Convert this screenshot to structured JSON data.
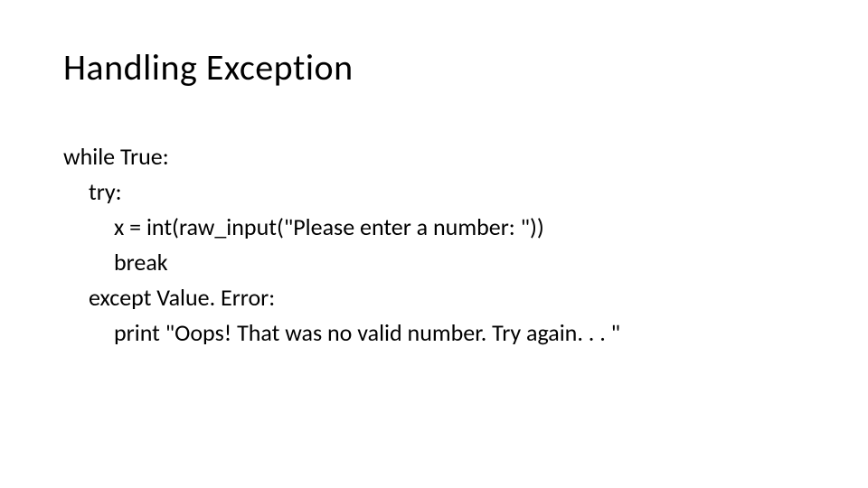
{
  "title": "Handling Exception",
  "code": {
    "line1": "while True:",
    "line2": "try:",
    "line3": "x = int(raw_input(\"Please enter a number: \"))",
    "line4": "break",
    "line5": "except Value. Error:",
    "line6": "print \"Oops!  That was no valid number.  Try again. . . \""
  }
}
